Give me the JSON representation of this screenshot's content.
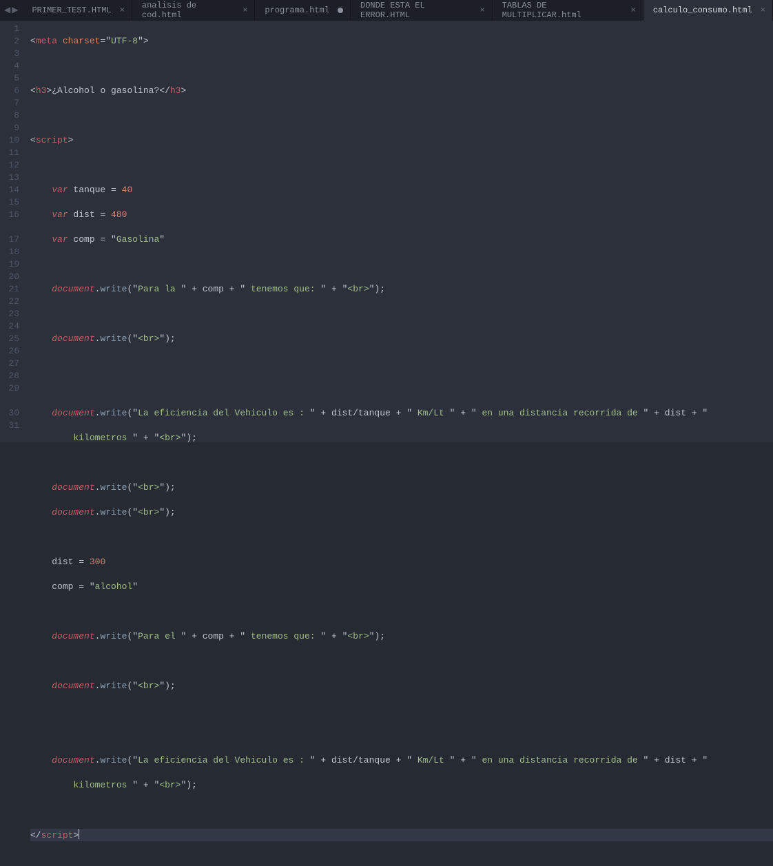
{
  "nav": {
    "left": "◀",
    "right": "▶"
  },
  "tabs": [
    {
      "label": "PRIMER_TEST.HTML",
      "active": false,
      "modified": false
    },
    {
      "label": "analisis de cod.html",
      "active": false,
      "modified": false
    },
    {
      "label": "programa.html",
      "active": false,
      "modified": true
    },
    {
      "label": "DONDE ESTA EL ERROR.HTML",
      "active": false,
      "modified": false
    },
    {
      "label": "TABLAS DE MULTIPLICAR.html",
      "active": false,
      "modified": false
    },
    {
      "label": "calculo_consumo.html",
      "active": true,
      "modified": false
    }
  ],
  "gutter": [
    "1",
    "2",
    "3",
    "4",
    "5",
    "6",
    "7",
    "8",
    "9",
    "10",
    "11",
    "12",
    "13",
    "14",
    "15",
    "16",
    "",
    "17",
    "18",
    "19",
    "20",
    "21",
    "22",
    "23",
    "24",
    "25",
    "26",
    "27",
    "28",
    "29",
    "",
    "30",
    "31"
  ],
  "code": {
    "l1": {
      "open": "<",
      "tag": "meta",
      "sp": " ",
      "attr": "charset",
      "eq": "=",
      "q1": "\"",
      "val": "UTF-8",
      "q2": "\"",
      "close": ">"
    },
    "l3": {
      "o1": "<",
      "t1": "h3",
      "c1": ">",
      "txt": "¿Alcohol o gasolina?",
      "o2": "</",
      "t2": "h3",
      "c2": ">"
    },
    "l5": {
      "o": "<",
      "t": "script",
      "c": ">"
    },
    "l7": {
      "kw": "var",
      "id": " tanque ",
      "eq": "= ",
      "num": "40"
    },
    "l8": {
      "kw": "var",
      "id": " dist ",
      "eq": "= ",
      "num": "480"
    },
    "l9": {
      "kw": "var",
      "id": " comp ",
      "eq": "= ",
      "q1": "\"",
      "str": "Gasolina",
      "q2": "\""
    },
    "l11": {
      "obj": "document",
      "dot": ".",
      "fn": "write",
      "op": "(",
      "q1": "\"",
      "s1": "Para la ",
      "q2": "\"",
      "p1": " + ",
      "id1": "comp",
      "p2": " + ",
      "q3": "\"",
      "s2": " tenemos que: ",
      "q4": "\"",
      "p3": " + ",
      "q5": "\"",
      "s3": "<br>",
      "q6": "\"",
      "cl": ");"
    },
    "l13": {
      "obj": "document",
      "dot": ".",
      "fn": "write",
      "op": "(",
      "q1": "\"",
      "s1": "<br>",
      "q2": "\"",
      "cl": ");"
    },
    "l16": {
      "obj": "document",
      "dot": ".",
      "fn": "write",
      "op": "(",
      "q1": "\"",
      "s1": "La eficiencia del Vehiculo es : ",
      "q2": "\"",
      "p1": " + ",
      "id1": "dist",
      "sl": "/",
      "id2": "tanque",
      "p2": " + ",
      "q3": "\"",
      "s2": " Km/Lt ",
      "q4": "\"",
      "p3": " + ",
      "q5": "\"",
      "s3": " en una distancia recorrida de ",
      "q6": "\"",
      "p4": " + ",
      "id3": "dist",
      "p5": " + ",
      "q7": "\""
    },
    "l16b": {
      "s1": "kilometros ",
      "q1": "\"",
      "p1": " + ",
      "q2": "\"",
      "s2": "<br>",
      "q3": "\"",
      "cl": ");"
    },
    "l18": {
      "obj": "document",
      "dot": ".",
      "fn": "write",
      "op": "(",
      "q1": "\"",
      "s1": "<br>",
      "q2": "\"",
      "cl": ");"
    },
    "l19": {
      "obj": "document",
      "dot": ".",
      "fn": "write",
      "op": "(",
      "q1": "\"",
      "s1": "<br>",
      "q2": "\"",
      "cl": ");"
    },
    "l21": {
      "id": "dist ",
      "eq": "= ",
      "num": "300"
    },
    "l22": {
      "id": "comp ",
      "eq": "= ",
      "q1": "\"",
      "str": "alcohol",
      "q2": "\""
    },
    "l24": {
      "obj": "document",
      "dot": ".",
      "fn": "write",
      "op": "(",
      "q1": "\"",
      "s1": "Para el ",
      "q2": "\"",
      "p1": " + ",
      "id1": "comp",
      "p2": " + ",
      "q3": "\"",
      "s2": " tenemos que: ",
      "q4": "\"",
      "p3": " + ",
      "q5": "\"",
      "s3": "<br>",
      "q6": "\"",
      "cl": ");"
    },
    "l26": {
      "obj": "document",
      "dot": ".",
      "fn": "write",
      "op": "(",
      "q1": "\"",
      "s1": "<br>",
      "q2": "\"",
      "cl": ");"
    },
    "l29": {
      "obj": "document",
      "dot": ".",
      "fn": "write",
      "op": "(",
      "q1": "\"",
      "s1": "La eficiencia del Vehiculo es : ",
      "q2": "\"",
      "p1": " + ",
      "id1": "dist",
      "sl": "/",
      "id2": "tanque",
      "p2": " + ",
      "q3": "\"",
      "s2": " Km/Lt ",
      "q4": "\"",
      "p3": " + ",
      "q5": "\"",
      "s3": " en una distancia recorrida de ",
      "q6": "\"",
      "p4": " + ",
      "id3": "dist",
      "p5": " + ",
      "q7": "\""
    },
    "l29b": {
      "s1": "kilometros ",
      "q1": "\"",
      "p1": " + ",
      "q2": "\"",
      "s2": "<br>",
      "q3": "\"",
      "cl": ");"
    },
    "l31": {
      "o": "</",
      "t": "script",
      "c": ">"
    }
  }
}
